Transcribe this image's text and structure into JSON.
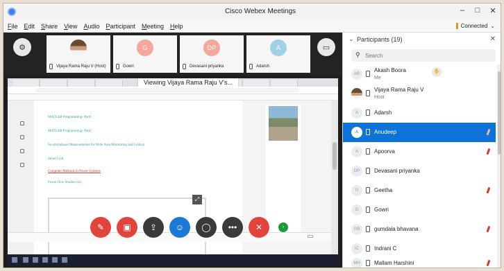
{
  "window": {
    "title": "Cisco Webex Meetings",
    "controls": [
      "–",
      "□",
      "✕"
    ]
  },
  "menu": {
    "items": [
      "File",
      "Edit",
      "Share",
      "View",
      "Audio",
      "Participant",
      "Meeting",
      "Help"
    ],
    "connection_status": "Connected"
  },
  "video_strip": {
    "tiles": [
      {
        "initials": "",
        "name": "Vijaya Rama Raju V (Host)",
        "photo": true
      },
      {
        "initials": "G",
        "name": "Gowri",
        "color": "#f4a79c"
      },
      {
        "initials": "DP",
        "name": "Devasani priyanka",
        "color": "#f4a79c"
      },
      {
        "initials": "A",
        "name": "Adarsh",
        "color": "#9fd0e6"
      }
    ]
  },
  "share": {
    "viewing_label": "Viewing Vijaya Rama Raju V's...",
    "page_links": [
      {
        "text": "MATLAB Programming- Part1",
        "style": "teal"
      },
      {
        "text": "MATLAB Programming- Part2",
        "style": "teal"
      },
      {
        "text": "Synchrophasor Measurements for Wide Area Monitoring and Control",
        "style": "teal"
      },
      {
        "text": "Smart Grid",
        "style": "teal"
      },
      {
        "text": "Computer Methods in Power Systems",
        "style": "red"
      },
      {
        "text": "Power flow Studies (dc)",
        "style": "teal"
      }
    ]
  },
  "participants": {
    "header": "Participants (19)",
    "search_placeholder": "Search",
    "list": [
      {
        "initials": "AB",
        "name": "Akash Boora",
        "role": "Me",
        "selected": false,
        "muted": false,
        "hand": true
      },
      {
        "initials": "",
        "name": "Vijaya Rama Raju V",
        "role": "Host",
        "photo": true,
        "selected": false,
        "muted": false
      },
      {
        "initials": "A",
        "name": "Adarsh",
        "role": "",
        "selected": false,
        "muted": true
      },
      {
        "initials": "A",
        "name": "Anudeep",
        "role": "",
        "selected": true,
        "muted": true
      },
      {
        "initials": "A",
        "name": "Apoorva",
        "role": "",
        "selected": false,
        "muted": true
      },
      {
        "initials": "DP",
        "name": "Devasani priyanka",
        "role": "",
        "selected": false,
        "muted": true
      },
      {
        "initials": "G",
        "name": "Geetha",
        "role": "",
        "selected": false,
        "muted": true
      },
      {
        "initials": "G",
        "name": "Gowri",
        "role": "",
        "selected": false,
        "muted": true
      },
      {
        "initials": "GB",
        "name": "gumdala bhavana",
        "role": "",
        "selected": false,
        "muted": true
      },
      {
        "initials": "IC",
        "name": "Indrani C",
        "role": "",
        "selected": false,
        "muted": false
      },
      {
        "initials": "MH",
        "name": "Mallam Harshini",
        "role": "",
        "selected": false,
        "muted": true
      }
    ]
  },
  "controls": [
    {
      "name": "mute-button",
      "color": "#e0443b",
      "glyph": "🎤"
    },
    {
      "name": "stop-video-button",
      "color": "#e0443b",
      "glyph": "▶"
    },
    {
      "name": "share-button",
      "color": "#3a3a3a",
      "glyph": "⇪"
    },
    {
      "name": "participants-button",
      "color": "#1b79d8",
      "glyph": "👤"
    },
    {
      "name": "chat-button",
      "color": "#3a3a3a",
      "glyph": "◯"
    },
    {
      "name": "more-button",
      "color": "#3a3a3a",
      "glyph": "•••"
    },
    {
      "name": "leave-button",
      "color": "#e0443b",
      "glyph": "✕"
    }
  ]
}
